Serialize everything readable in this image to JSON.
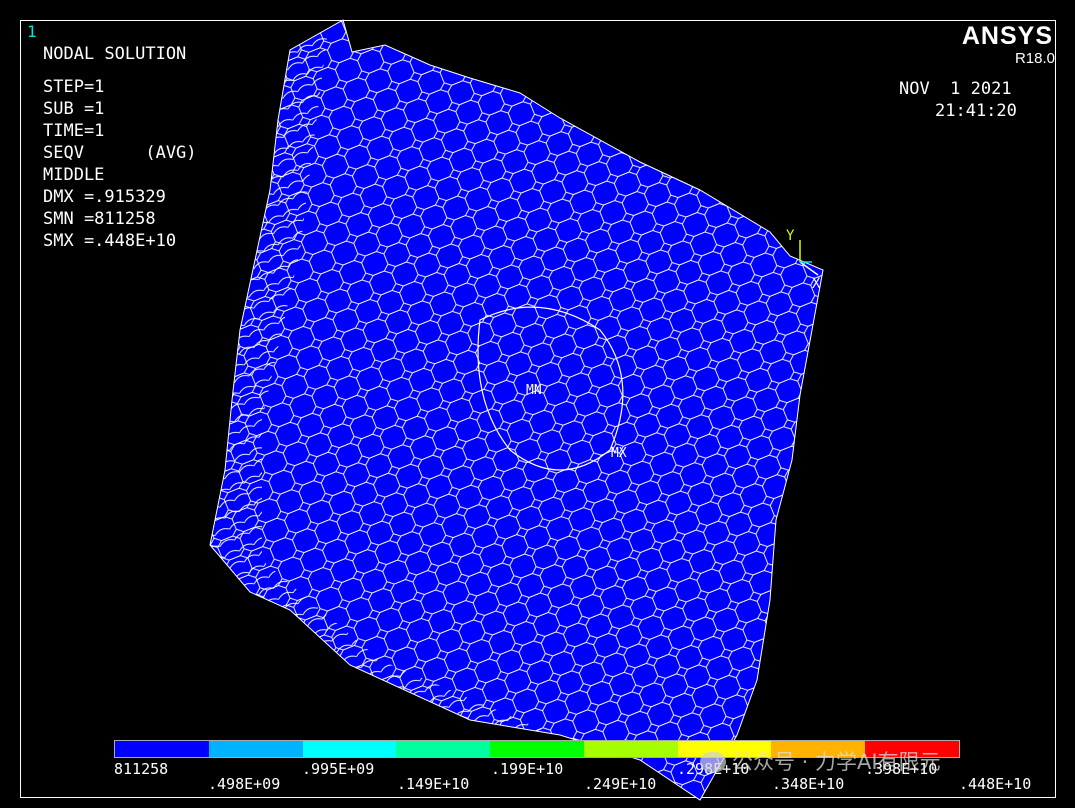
{
  "window": {
    "number": "1"
  },
  "logo": {
    "name": "ANSYS",
    "version": "R18.0"
  },
  "info": {
    "title": "NODAL SOLUTION",
    "step": "STEP=1",
    "sub": "SUB =1",
    "time": "TIME=1",
    "result": "SEQV      (AVG)",
    "layer": "MIDDLE",
    "dmx": "DMX =.915329",
    "smn": "SMN =811258",
    "smx": "SMX =.448E+10"
  },
  "date": "NOV  1 2021",
  "clock": "21:41:20",
  "markers": {
    "min": "MN",
    "max": "MX"
  },
  "triad": {
    "y": "Y",
    "x": "X"
  },
  "colors": {
    "background": "#000000",
    "mesh_fill": "#0000ff",
    "mesh_edge": "#ffffff",
    "legend": [
      "#0000ff",
      "#00b2ff",
      "#00ffff",
      "#00ff9e",
      "#00ff00",
      "#a6ff00",
      "#ffff00",
      "#ffb200",
      "#ff0000"
    ]
  },
  "legend": {
    "top_labels": [
      "811258",
      ".995E+09",
      ".199E+10",
      ".298E+10",
      ".398E+10"
    ],
    "bottom_labels": [
      ".498E+09",
      ".149E+10",
      ".249E+10",
      ".348E+10",
      ".448E+10"
    ]
  },
  "watermark": "公众号 · 力学AI有限元"
}
